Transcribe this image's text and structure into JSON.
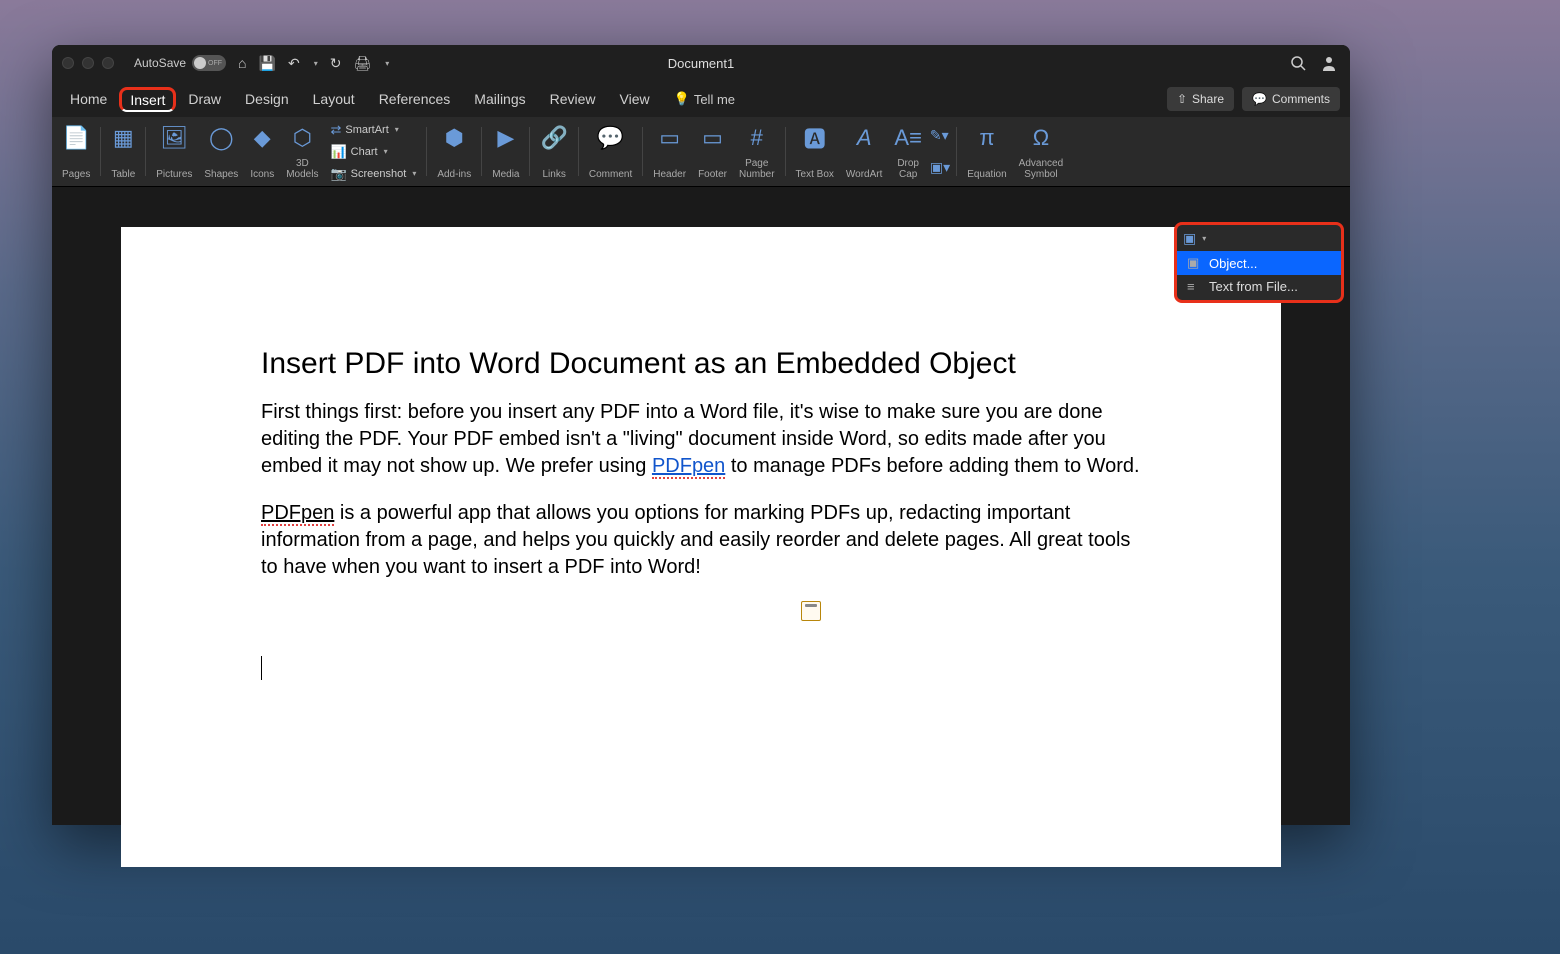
{
  "titlebar": {
    "autosave_label": "AutoSave",
    "autosave_state": "OFF",
    "document_title": "Document1"
  },
  "tabs": {
    "items": [
      "Home",
      "Insert",
      "Draw",
      "Design",
      "Layout",
      "References",
      "Mailings",
      "Review",
      "View"
    ],
    "active_index": 1,
    "tellme": "Tell me",
    "share": "Share",
    "comments": "Comments"
  },
  "ribbon": {
    "pages": "Pages",
    "table": "Table",
    "pictures": "Pictures",
    "shapes": "Shapes",
    "icons": "Icons",
    "models": "3D\nModels",
    "smartart": "SmartArt",
    "chart": "Chart",
    "screenshot": "Screenshot",
    "addins": "Add-ins",
    "media": "Media",
    "links": "Links",
    "comment": "Comment",
    "header": "Header",
    "footer": "Footer",
    "pagenum": "Page\nNumber",
    "textbox": "Text Box",
    "wordart": "WordArt",
    "dropcap": "Drop\nCap",
    "equation": "Equation",
    "symbol": "Advanced\nSymbol"
  },
  "dropdown": {
    "object": "Object...",
    "textfromfile": "Text from File..."
  },
  "document": {
    "heading": "Insert PDF into Word Document as an Embedded Object",
    "p1_a": "First things first: before you insert any PDF into a Word file, it's wise to make sure you are done editing the PDF. Your PDF embed isn't a \"living\" document inside Word, so edits made after you embed it may not show up. We prefer using ",
    "p1_link": "PDFpen",
    "p1_b": " to manage PDFs before adding them to Word.",
    "p2_a": "PDFpen",
    "p2_b": " is a powerful app that allows you options for marking PDFs up, redacting important information from a page, and helps you quickly and easily reorder and delete pages. All great tools to have when you want to insert a PDF into Word!"
  }
}
